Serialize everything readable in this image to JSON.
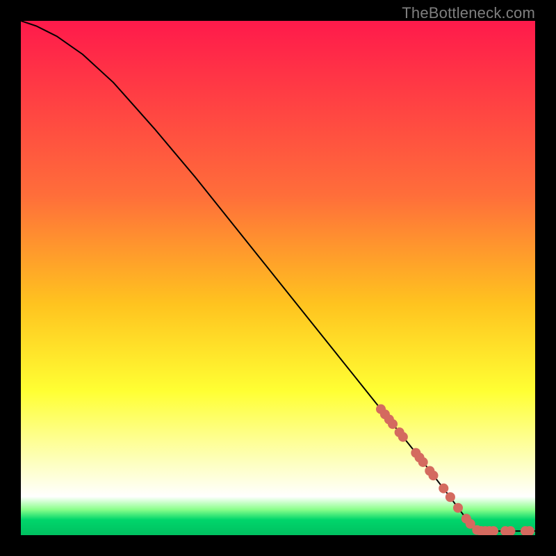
{
  "watermark": "TheBottleneck.com",
  "chart_data": {
    "type": "line",
    "title": "",
    "xlabel": "",
    "ylabel": "",
    "xlim": [
      0,
      100
    ],
    "ylim": [
      0,
      100
    ],
    "gradient_stops": [
      {
        "offset": 0,
        "color": "#ff1a4b"
      },
      {
        "offset": 34,
        "color": "#ff6e3a"
      },
      {
        "offset": 55,
        "color": "#ffc31f"
      },
      {
        "offset": 72,
        "color": "#ffff33"
      },
      {
        "offset": 86,
        "color": "#fdffc0"
      },
      {
        "offset": 92.5,
        "color": "#ffffff"
      },
      {
        "offset": 95,
        "color": "#8bff8b"
      },
      {
        "offset": 97,
        "color": "#00d66b"
      },
      {
        "offset": 100,
        "color": "#00c060"
      }
    ],
    "series": [
      {
        "name": "curve",
        "stroke": "#000000",
        "points": [
          {
            "x": 0,
            "y": 100
          },
          {
            "x": 3,
            "y": 99
          },
          {
            "x": 7,
            "y": 97
          },
          {
            "x": 12,
            "y": 93.5
          },
          {
            "x": 18,
            "y": 88
          },
          {
            "x": 26,
            "y": 79
          },
          {
            "x": 34,
            "y": 69.5
          },
          {
            "x": 42,
            "y": 59.5
          },
          {
            "x": 50,
            "y": 49.5
          },
          {
            "x": 58,
            "y": 39.5
          },
          {
            "x": 66,
            "y": 29.5
          },
          {
            "x": 72,
            "y": 22
          },
          {
            "x": 78,
            "y": 14.5
          },
          {
            "x": 83,
            "y": 8
          },
          {
            "x": 86,
            "y": 4
          },
          {
            "x": 88,
            "y": 1.8
          },
          {
            "x": 89,
            "y": 1
          },
          {
            "x": 91,
            "y": 0.8
          },
          {
            "x": 94,
            "y": 0.8
          },
          {
            "x": 97,
            "y": 0.8
          },
          {
            "x": 100,
            "y": 0.8
          }
        ]
      }
    ],
    "markers": {
      "color": "#d46a5f",
      "radius_pct": 0.95,
      "points": [
        {
          "x": 70.0,
          "y": 24.5
        },
        {
          "x": 70.8,
          "y": 23.5
        },
        {
          "x": 71.6,
          "y": 22.5
        },
        {
          "x": 72.3,
          "y": 21.6
        },
        {
          "x": 73.6,
          "y": 20.0
        },
        {
          "x": 74.3,
          "y": 19.1
        },
        {
          "x": 76.8,
          "y": 16.0
        },
        {
          "x": 77.5,
          "y": 15.1
        },
        {
          "x": 78.2,
          "y": 14.2
        },
        {
          "x": 79.5,
          "y": 12.5
        },
        {
          "x": 80.2,
          "y": 11.6
        },
        {
          "x": 82.2,
          "y": 9.1
        },
        {
          "x": 83.5,
          "y": 7.4
        },
        {
          "x": 85.0,
          "y": 5.3
        },
        {
          "x": 86.6,
          "y": 3.2
        },
        {
          "x": 87.4,
          "y": 2.2
        },
        {
          "x": 88.7,
          "y": 1.0
        },
        {
          "x": 89.5,
          "y": 0.8
        },
        {
          "x": 90.3,
          "y": 0.8
        },
        {
          "x": 91.1,
          "y": 0.8
        },
        {
          "x": 91.9,
          "y": 0.8
        },
        {
          "x": 94.2,
          "y": 0.8
        },
        {
          "x": 95.2,
          "y": 0.8
        },
        {
          "x": 98.1,
          "y": 0.8
        },
        {
          "x": 98.9,
          "y": 0.8
        }
      ]
    }
  }
}
